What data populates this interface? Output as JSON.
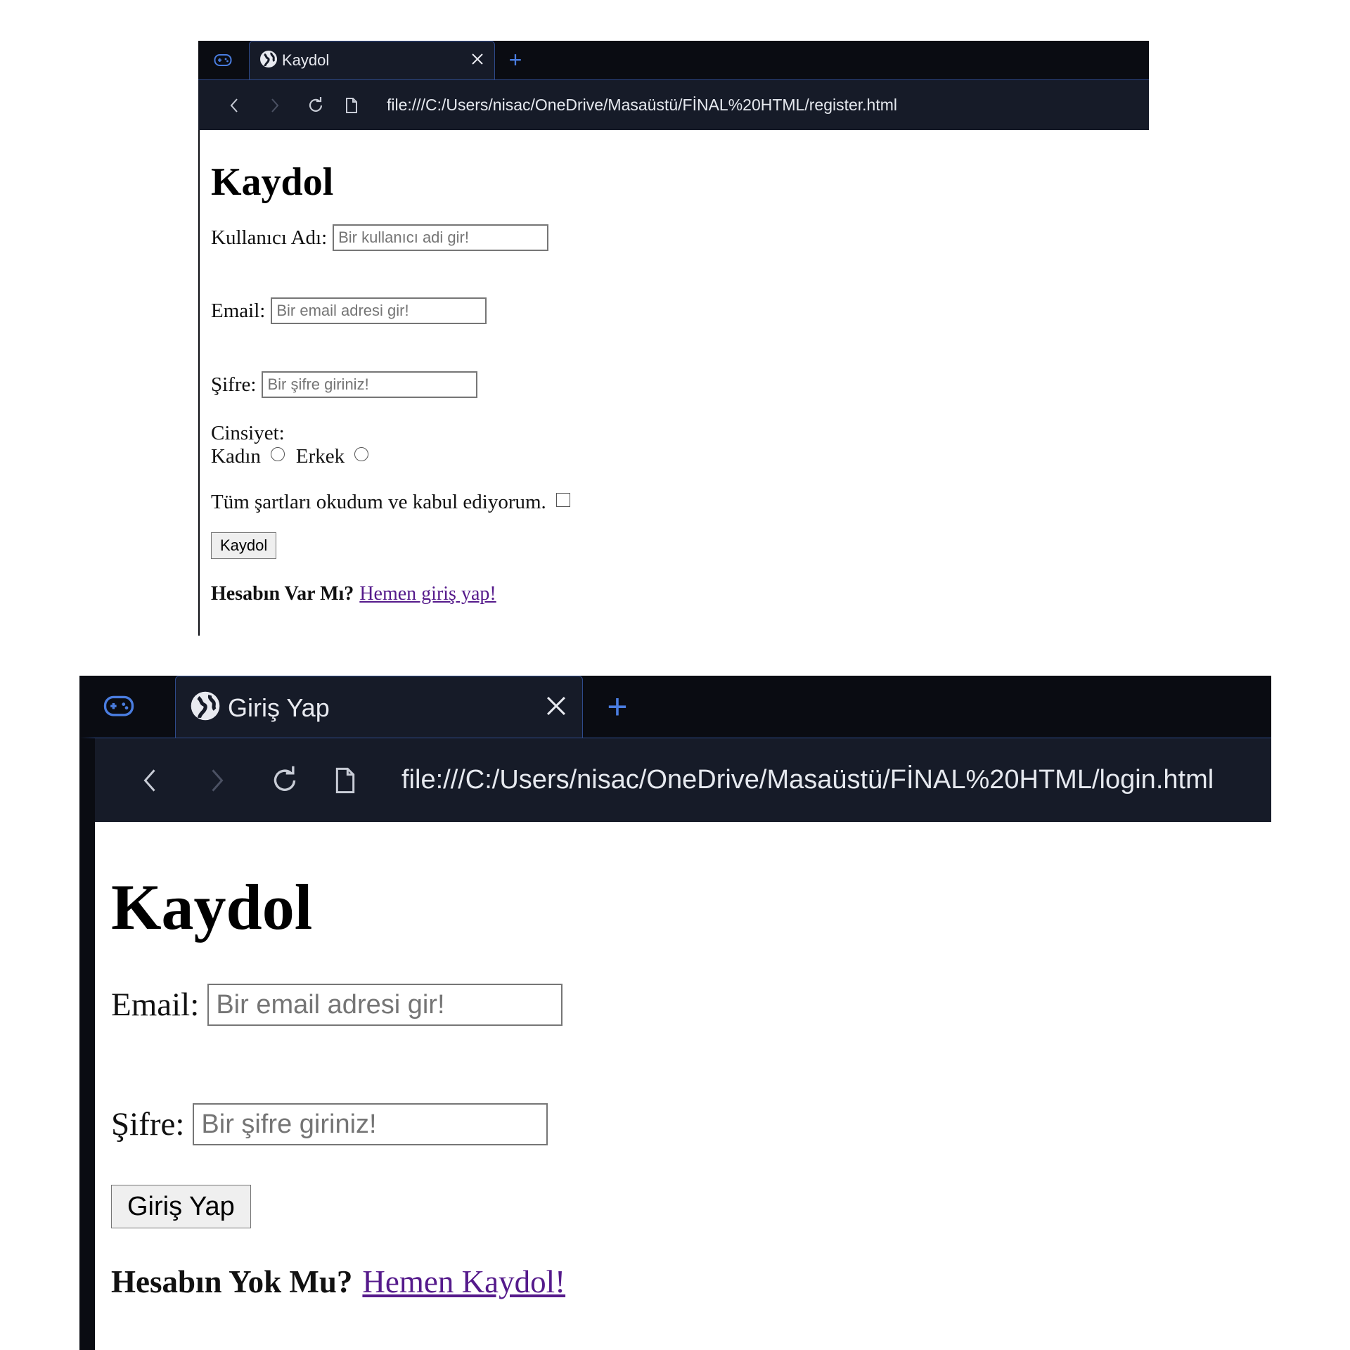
{
  "register_window": {
    "tab": {
      "title": "Kaydol",
      "favicon": "globe-icon"
    },
    "new_tab": "+",
    "address_bar": {
      "url": "file:///C:/Users/nisac/OneDrive/Masaüstü/FİNAL%20HTML/register.html"
    },
    "page": {
      "heading": "Kaydol",
      "username": {
        "label": "Kullanıcı Adı:",
        "placeholder": "Bir kullanıcı adi gir!"
      },
      "email": {
        "label": "Email:",
        "placeholder": "Bir email adresi gir!"
      },
      "password": {
        "label": "Şifre:",
        "placeholder": "Bir şifre giriniz!"
      },
      "gender": {
        "label": "Cinsiyet:",
        "female": "Kadın",
        "male": "Erkek"
      },
      "terms": "Tüm şartları okudum ve kabul ediyorum.",
      "submit": "Kaydol",
      "footer": {
        "text": "Hesabın Var Mı?",
        "link": "Hemen giriş yap!"
      }
    }
  },
  "login_window": {
    "tab": {
      "title": "Giriş Yap",
      "favicon": "globe-icon"
    },
    "new_tab": "+",
    "address_bar": {
      "url": "file:///C:/Users/nisac/OneDrive/Masaüstü/FİNAL%20HTML/login.html"
    },
    "page": {
      "heading": "Kaydol",
      "email": {
        "label": "Email:",
        "placeholder": "Bir email adresi gir!"
      },
      "password": {
        "label": "Şifre:",
        "placeholder": "Bir şifre giriniz!"
      },
      "submit": "Giriş Yap",
      "footer": {
        "text": "Hesabın Yok Mu?",
        "link": "Hemen Kaydol!"
      }
    }
  },
  "colors": {
    "chrome_dark": "#0a0c12",
    "toolbar": "#161b28",
    "accent_blue": "#4a7de0",
    "visited_link": "#551a8b"
  }
}
